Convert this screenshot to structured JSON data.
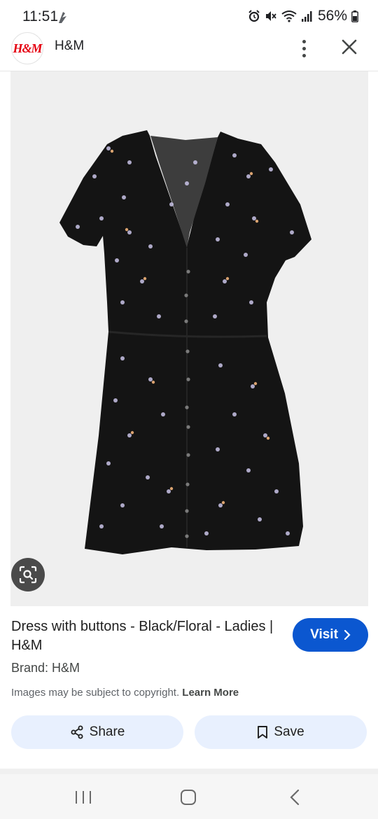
{
  "status_bar": {
    "time": "11:51",
    "battery": "56%",
    "icons": [
      "alarm-icon",
      "mute-icon",
      "wifi-icon",
      "signal-icon",
      "battery-icon"
    ]
  },
  "header": {
    "logo_text": "H&M",
    "title": "H&M",
    "icons": [
      "more-vert-icon",
      "close-icon"
    ]
  },
  "image": {
    "subject": "black floral print short-sleeve button-front dress",
    "lens_icon": "lens-search-icon"
  },
  "result": {
    "title": "Dress with buttons - Black/Floral - Ladies | H&M",
    "visit_label": "Visit",
    "brand": "Brand: H&M",
    "copyright_text": "Images may be subject to copyright.",
    "learn_more": "Learn More",
    "share_label": "Share",
    "save_label": "Save"
  },
  "nav": {
    "icons": [
      "recents-icon",
      "home-icon",
      "back-icon"
    ]
  },
  "colors": {
    "accent": "#0b57d0",
    "pill_bg": "#e8f0fe",
    "brand_red": "#e50010",
    "image_bg": "#efefef"
  }
}
